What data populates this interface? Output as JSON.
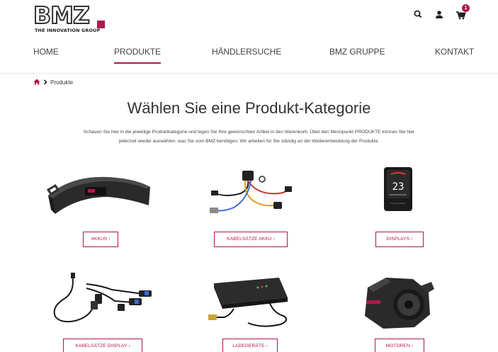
{
  "logo": {
    "name": "BMZ",
    "tagline": "THE INNOVATION GROUP"
  },
  "header": {
    "cart_count": "1"
  },
  "nav": [
    {
      "label": "HOME"
    },
    {
      "label": "PRODUKTE"
    },
    {
      "label": "HÄNDLERSUCHE"
    },
    {
      "label": "BMZ GRUPPE"
    },
    {
      "label": "KONTAKT"
    }
  ],
  "breadcrumb": {
    "current": "Produkte"
  },
  "page": {
    "title": "Wählen Sie eine Produkt-Kategorie",
    "intro_line1": "Schauen Sie hier in die jeweilige Produktkategorie und legen Sie Ihre gewünschten Artikel in den Warenkorb. Über den Menüpunkt PRODUKTE können Sie hier",
    "intro_line2": "jederzeit wieder auswählen, was Sie vom BMZ benötigen. Wir arbeiten für Sie ständig an der Weiterentwicklung der Produkte."
  },
  "categories": [
    {
      "label": "AKKUS ›"
    },
    {
      "label": "KABELSÄTZE AKKU ›"
    },
    {
      "label": "DISPLAYS ›"
    },
    {
      "label": "KABELSÄTZE DISPLAY ›"
    },
    {
      "label": "LADEGERÄTE ›"
    },
    {
      "label": "MOTOREN ›"
    }
  ],
  "colors": {
    "accent": "#b0174c",
    "text": "#333333"
  }
}
